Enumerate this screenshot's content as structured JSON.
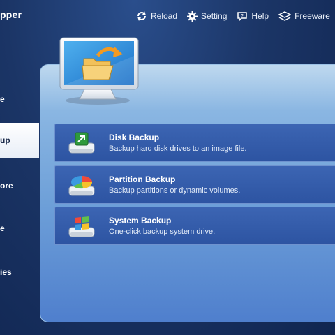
{
  "app": {
    "title": "pper"
  },
  "toolbar": {
    "reload": "Reload",
    "setting": "Setting",
    "help": "Help",
    "freeware": "Freeware"
  },
  "sidebar": {
    "items": [
      {
        "label": "e"
      },
      {
        "label": "up"
      },
      {
        "label": "ore"
      },
      {
        "label": "e"
      },
      {
        "label": "ies"
      }
    ]
  },
  "cards": [
    {
      "title": "Disk Backup",
      "desc": "Backup hard disk drives to an image file.",
      "icon": "disk-icon"
    },
    {
      "title": "Partition Backup",
      "desc": "Backup partitions or dynamic volumes.",
      "icon": "partition-icon"
    },
    {
      "title": "System Backup",
      "desc": "One-click backup system drive.",
      "icon": "windows-icon"
    }
  ]
}
